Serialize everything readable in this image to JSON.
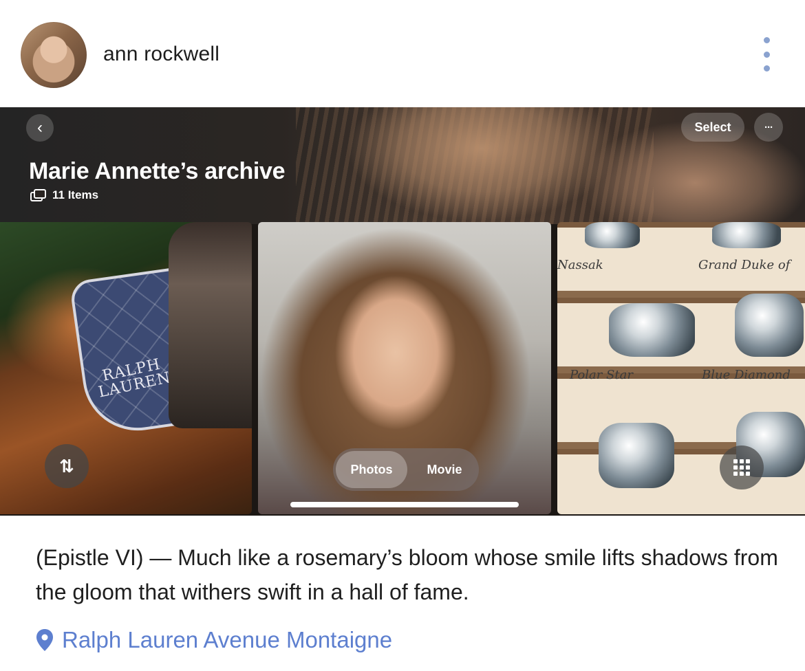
{
  "post": {
    "username": "ann rockwell",
    "caption": "(Epistle VI) — Much like a rosemary’s bloom whose smile lifts shadows from the gloom that withers swift in a hall of fame.",
    "location": "Ralph Lauren Avenue Montaigne"
  },
  "album": {
    "title": "Marie Annette’s archive",
    "count_label": "11 Items",
    "select_label": "Select",
    "more_label": "···",
    "back_label": "‹",
    "sort_label": "⇅",
    "view_toggle": {
      "photos_label": "Photos",
      "movie_label": "Movie",
      "selected": "Photos"
    },
    "horse_pad_text": "RALPH\nLAUREN",
    "gem_labels": [
      "Polar Star",
      "Blue Diamond",
      "Nassak",
      "Grand Duke of"
    ]
  },
  "colors": {
    "link": "#5d7fcf",
    "kebab": "#8aa2cf",
    "text": "#1f1f1f"
  },
  "icons": [
    "avatar",
    "more-vertical-icon",
    "chevron-left-icon",
    "more-horizontal-icon",
    "photo-stack-icon",
    "sort-icon",
    "grid-icon",
    "location-pin-icon"
  ]
}
